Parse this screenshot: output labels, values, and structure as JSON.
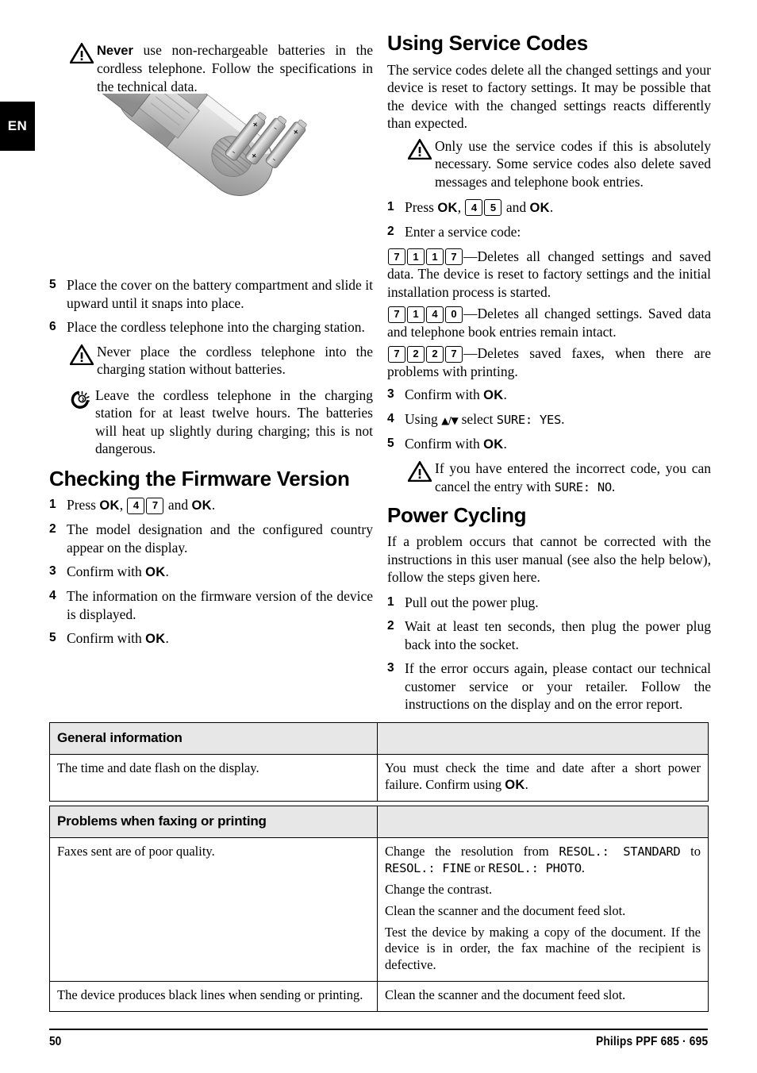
{
  "language_tab": "EN",
  "left_column": {
    "warning_top": {
      "icon": "warning-triangle-icon",
      "lead": "Never",
      "text": " use non-rechargeable batteries in the cordless telephone. Follow the specifications in the technical data."
    },
    "illustration": {
      "name": "cordless-telephone-battery-illustration",
      "description": "Cordless telephone handset with the battery compartment cover removed and three batteries"
    },
    "steps": [
      {
        "num": "5",
        "text": "Place the cover on the battery compartment and slide it upward until it snaps into place."
      },
      {
        "num": "6",
        "text": "Place the cordless telephone into the charging station."
      }
    ],
    "warning_charging": {
      "icon": "warning-triangle-icon",
      "text": "Never place the cordless telephone into the charging station without batteries."
    },
    "tip_charging": {
      "icon": "lightbulb-tip-icon",
      "text": "Leave the cordless telephone in the charging station for at least twelve hours. The batteries will heat up slightly during charging; this is not dangerous."
    },
    "firmware_section": {
      "heading": "Checking the Firmware Version",
      "steps": [
        {
          "num": "1",
          "pre": "Press ",
          "ok1": "OK",
          "comma": ", ",
          "keys": [
            "4",
            "7"
          ],
          "mid": " and ",
          "ok2": "OK",
          "post": "."
        },
        {
          "num": "2",
          "text": "The model designation and the configured country appear on the display."
        },
        {
          "num": "3",
          "pre": "Confirm with ",
          "ok1": "OK",
          "post": "."
        },
        {
          "num": "4",
          "text": "The information on the firmware version of the device is displayed."
        },
        {
          "num": "5",
          "pre": "Confirm with ",
          "ok1": "OK",
          "post": "."
        }
      ]
    }
  },
  "right_column": {
    "service_section": {
      "heading": "Using Service Codes",
      "intro": "The service codes delete all the changed settings and your device is reset to factory settings. It may be possible that the device with the changed settings reacts differently than expected.",
      "warning": {
        "icon": "warning-triangle-icon",
        "text": "Only use the service codes if this is absolutely necessary. Some service codes also delete saved messages and telephone book entries."
      },
      "step1": {
        "num": "1",
        "pre": "Press ",
        "ok1": "OK",
        "comma": ", ",
        "keys": [
          "4",
          "5"
        ],
        "mid": " and ",
        "ok2": "OK",
        "post": "."
      },
      "step2": {
        "num": "2",
        "text": "Enter a service code:"
      },
      "codes": [
        {
          "keys": [
            "7",
            "1",
            "1",
            "7"
          ],
          "text": "—Deletes all changed settings and saved data. The device is reset to factory settings and the initial installation process is started."
        },
        {
          "keys": [
            "7",
            "1",
            "4",
            "0"
          ],
          "text": "—Deletes all changed settings. Saved data and telephone book entries remain intact."
        },
        {
          "keys": [
            "7",
            "2",
            "2",
            "7"
          ],
          "text": "—Deletes saved faxes, when there are problems with printing."
        }
      ],
      "step3": {
        "num": "3",
        "pre": "Confirm with ",
        "ok1": "OK",
        "post": "."
      },
      "step4": {
        "num": "4",
        "pre": "Using ",
        "arrows": "▲/▼",
        "mid": " select ",
        "lcd": "SURE: YES",
        "post": "."
      },
      "step5": {
        "num": "5",
        "pre": "Confirm with ",
        "ok1": "OK",
        "post": "."
      },
      "warning_incorrect": {
        "icon": "warning-triangle-icon",
        "pre": "If you have entered the incorrect code, you can cancel the entry with ",
        "lcd": "SURE: NO",
        "post": "."
      }
    },
    "power_section": {
      "heading": "Power Cycling",
      "intro": "If a problem occurs that cannot be corrected with the instructions in this user manual (see also the help below), follow the steps given here.",
      "steps": [
        {
          "num": "1",
          "text": "Pull out the power plug."
        },
        {
          "num": "2",
          "text": "Wait at least ten seconds, then plug the power plug back into the socket."
        },
        {
          "num": "3",
          "text": "If the error occurs again, please contact our technical customer service or your retailer. Follow the instructions on the display and on the error report."
        }
      ]
    }
  },
  "tables": [
    {
      "id": "general",
      "header": {
        "c1": "General information",
        "c2": ""
      },
      "rows": [
        {
          "c1": "The time and date flash on the display.",
          "c2_parts": {
            "pre": "You must check the time and date after a short power failure. Confirm using ",
            "ok": "OK",
            "post": "."
          }
        }
      ]
    },
    {
      "id": "faxing",
      "header": {
        "c1": "Problems when faxing or printing",
        "c2": ""
      },
      "rows": [
        {
          "c1": "Faxes sent are of poor quality.",
          "c2_lines": {
            "line1_pre": "Change the resolution from ",
            "line1_lcd1": "RESOL.: STANDARD",
            "line1_mid": " to ",
            "line1_lcd2": "RESOL.: FINE",
            "line1_or": " or ",
            "line1_lcd3": "RESOL.: PHOTO",
            "line1_post": ".",
            "line2": "Change the contrast.",
            "line3": "Clean the scanner and the document feed slot.",
            "line4": "Test the device by making a copy of the document. If the device is in order, the fax machine of the recipient is defective."
          }
        },
        {
          "c1": "The device produces black lines when sending or printing.",
          "c2": "Clean the scanner and the document feed slot."
        }
      ]
    }
  ],
  "footer": {
    "page_number": "50",
    "brand": "Philips PPF 685 · 695"
  }
}
